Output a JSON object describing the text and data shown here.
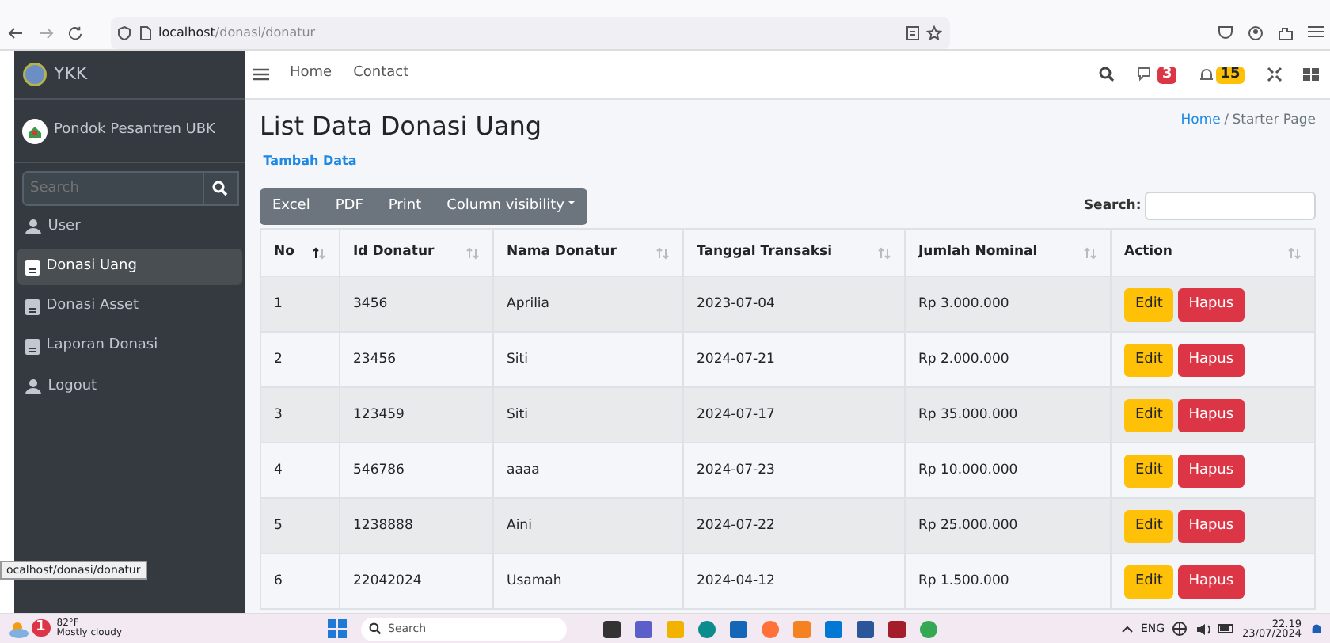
{
  "browser": {
    "url_host": "localhost",
    "url_path": "/donasi/donatur"
  },
  "sidebar": {
    "brand": "YKK",
    "user": "Pondok Pesantren UBK",
    "search": {
      "placeholder": "Search"
    },
    "items": [
      {
        "label": "User",
        "kind": "user",
        "selected": false
      },
      {
        "label": "Donasi Uang",
        "kind": "doc",
        "selected": true
      },
      {
        "label": "Donasi Asset",
        "kind": "doc",
        "selected": false
      },
      {
        "label": "Laporan Donasi",
        "kind": "doc",
        "selected": false
      },
      {
        "label": "Logout",
        "kind": "user",
        "selected": false
      }
    ]
  },
  "navbar": {
    "links": [
      "Home",
      "Contact"
    ],
    "messages_badge": "3",
    "notifications_badge": "15"
  },
  "page": {
    "title": "List Data Donasi Uang",
    "breadcrumb": [
      {
        "label": "Home",
        "active": false
      },
      {
        "label": "Starter Page",
        "active": true
      }
    ],
    "breadcrumb_separator": "/",
    "add_link": "Tambah Data"
  },
  "table_tools": {
    "buttons": [
      "Excel",
      "PDF",
      "Print",
      "Column visibility"
    ],
    "search_label": "Search:"
  },
  "table": {
    "columns": [
      {
        "label": "No",
        "sorted": true
      },
      {
        "label": "Id Donatur",
        "sorted": false
      },
      {
        "label": "Nama Donatur",
        "sorted": false
      },
      {
        "label": "Tanggal Transaksi",
        "sorted": false
      },
      {
        "label": "Jumlah Nominal",
        "sorted": false
      },
      {
        "label": "Action",
        "sorted": false
      }
    ],
    "rows": [
      {
        "cells": [
          "1",
          "3456",
          "Aprilia",
          "2023-07-04",
          "Rp 3.000.000"
        ],
        "actions": [
          "Edit",
          "Hapus"
        ]
      },
      {
        "cells": [
          "2",
          "23456",
          "Siti",
          "2024-07-21",
          "Rp 2.000.000"
        ],
        "actions": [
          "Edit",
          "Hapus"
        ]
      },
      {
        "cells": [
          "3",
          "123459",
          "Siti",
          "2024-07-17",
          "Rp 35.000.000"
        ],
        "actions": [
          "Edit",
          "Hapus"
        ]
      },
      {
        "cells": [
          "4",
          "546786",
          "aaaa",
          "2024-07-23",
          "Rp 10.000.000"
        ],
        "actions": [
          "Edit",
          "Hapus"
        ]
      },
      {
        "cells": [
          "5",
          "1238888",
          "Aini",
          "2024-07-22",
          "Rp 25.000.000"
        ],
        "actions": [
          "Edit",
          "Hapus"
        ]
      },
      {
        "cells": [
          "6",
          "22042024",
          "Usamah",
          "2024-04-12",
          "Rp 1.500.000"
        ],
        "actions": [
          "Edit",
          "Hapus"
        ]
      }
    ]
  },
  "status_url": "ocalhost/donasi/donatur",
  "taskbar": {
    "weather_badge": "1",
    "temperature": "82°F",
    "condition": "Mostly cloudy",
    "search": {
      "placeholder": "Search"
    },
    "language": "ENG",
    "time": "22.19",
    "date": "23/07/2024"
  }
}
